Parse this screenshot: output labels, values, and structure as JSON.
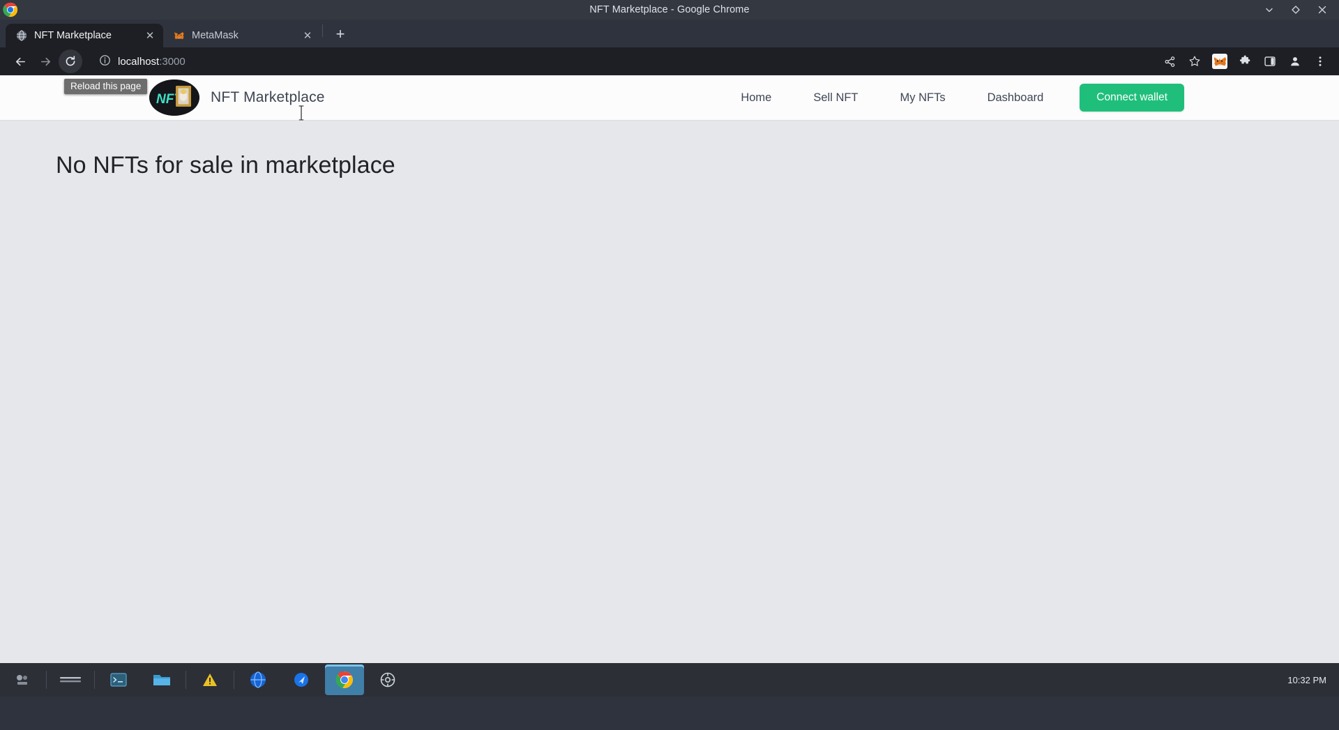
{
  "window": {
    "title": "NFT Marketplace - Google Chrome",
    "controls": [
      {
        "name": "minimize",
        "glyph": "⌄"
      },
      {
        "name": "maximize",
        "glyph": "◇"
      },
      {
        "name": "close",
        "glyph": "✕"
      }
    ]
  },
  "tabs": [
    {
      "title": "NFT Marketplace",
      "favicon": "globe-icon",
      "active": true,
      "close": "✕"
    },
    {
      "title": "MetaMask",
      "favicon": "metamask-fox-icon",
      "active": false,
      "close": "✕"
    }
  ],
  "newtab_label": "+",
  "toolbar": {
    "back_icon": "back-arrow-icon",
    "forward_icon": "forward-arrow-icon",
    "reload_icon": "reload-icon",
    "tooltip": "Reload this page",
    "site_info_icon": "site-info-icon",
    "url_host": "localhost",
    "url_port": ":3000",
    "url_full": "localhost:3000",
    "right_icons": [
      "share-icon",
      "bookmark-star-icon",
      "metamask-extension-icon",
      "extensions-puzzle-icon",
      "side-panel-icon",
      "profile-avatar-icon",
      "chrome-menu-icon"
    ]
  },
  "site": {
    "brand_name": "NFT Marketplace",
    "logo_text": "NFT",
    "nav": [
      {
        "label": "Home"
      },
      {
        "label": "Sell NFT"
      },
      {
        "label": "My NFTs"
      },
      {
        "label": "Dashboard"
      }
    ],
    "connect_wallet_label": "Connect wallet",
    "empty_state_heading": "No NFTs for sale in marketplace"
  },
  "colors": {
    "accent_green": "#1fbf7b",
    "page_bg": "#e5e7eb",
    "header_bg": "#fcfcfd",
    "chrome_dark": "#1d1f24",
    "titlebar": "#343841"
  },
  "taskbar": {
    "items": [
      "app-menu-icon",
      "window-list-icon",
      "terminal-icon",
      "files-icon",
      "warning-icon",
      "browser-icon",
      "browser2-icon",
      "chrome-icon",
      "settings-icon"
    ],
    "clock": "10:32 PM"
  }
}
